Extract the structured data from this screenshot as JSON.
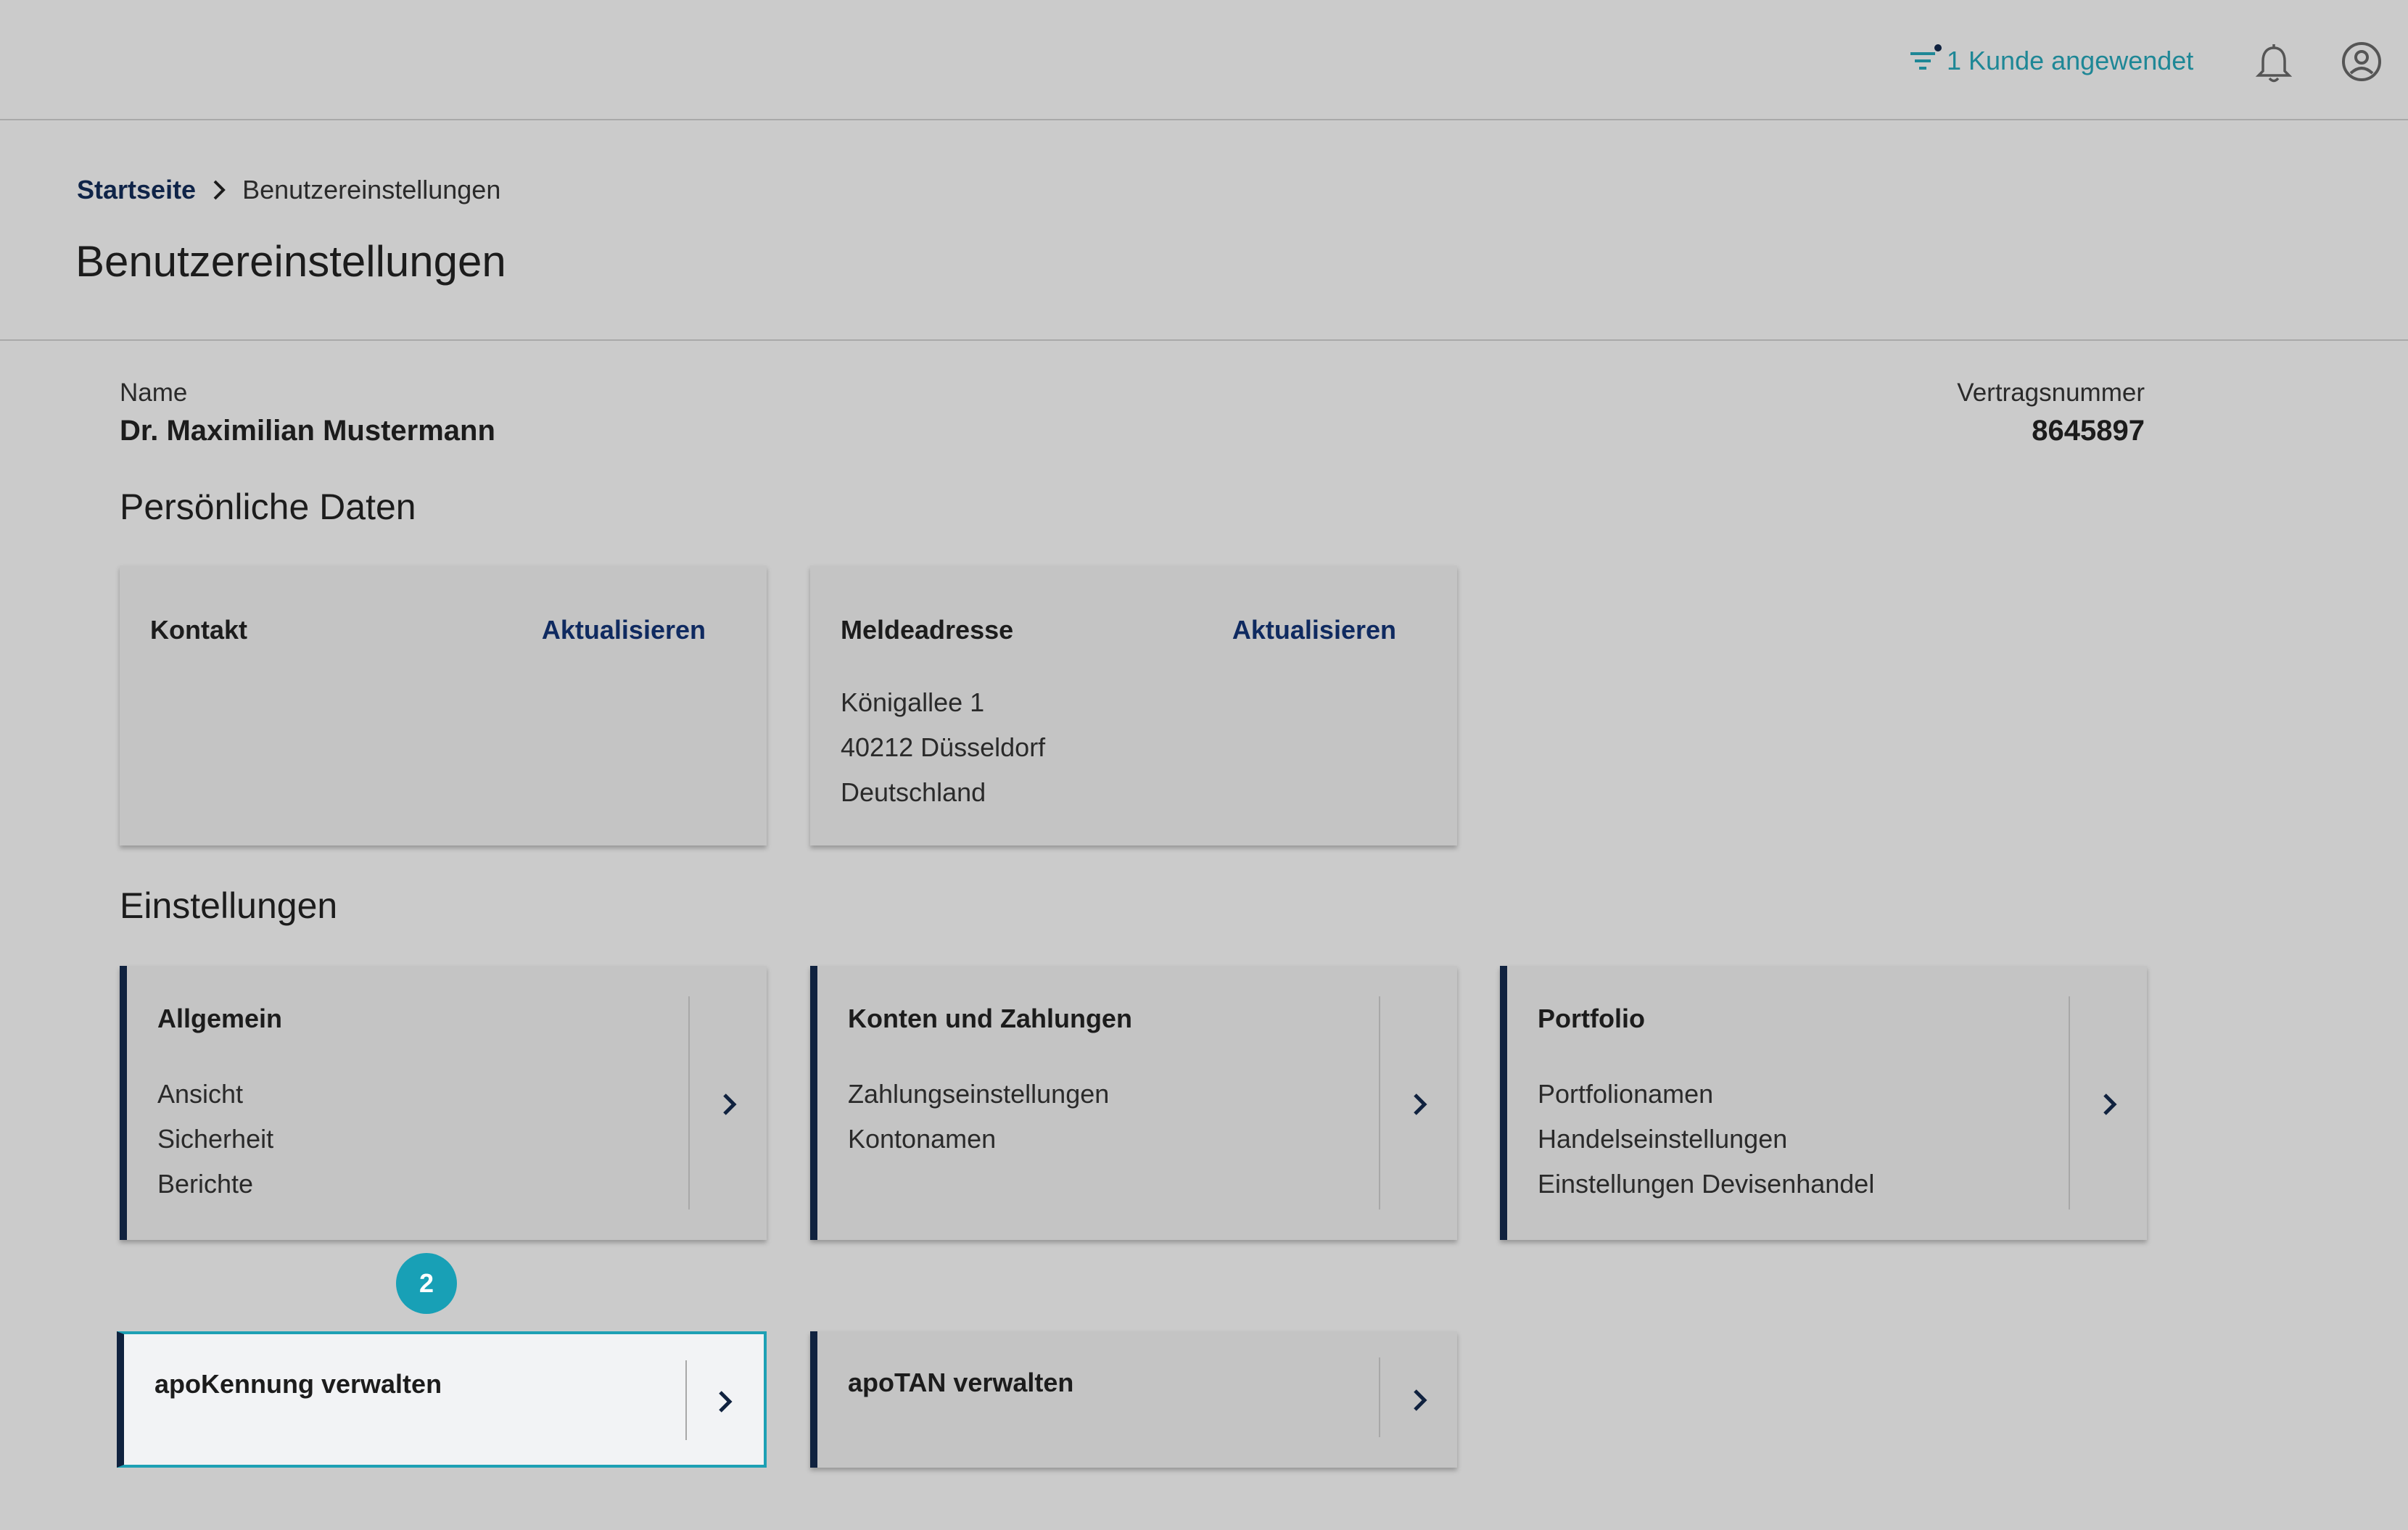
{
  "topbar": {
    "filter_label": "1 Kunde angewendet",
    "accent_color": "#1e8796"
  },
  "breadcrumb": {
    "home": "Startseite",
    "current": "Benutzereinstellungen"
  },
  "page_title": "Benutzereinstellungen",
  "profile": {
    "name_label": "Name",
    "name_value": "Dr. Maximilian Mustermann",
    "contract_label": "Vertragsnummer",
    "contract_value": "8645897"
  },
  "personal": {
    "title": "Persönliche Daten",
    "contact": {
      "title": "Kontakt",
      "action": "Aktualisieren"
    },
    "address": {
      "title": "Meldeadresse",
      "action": "Aktualisieren",
      "lines": [
        "Königallee 1",
        "40212 Düsseldorf",
        "Deutschland"
      ]
    }
  },
  "settings": {
    "title": "Einstellungen",
    "cards": [
      {
        "title": "Allgemein",
        "items": [
          "Ansicht",
          "Sicherheit",
          "Berichte"
        ]
      },
      {
        "title": "Konten und Zahlungen",
        "items": [
          "Zahlungseinstellungen",
          "Kontonamen"
        ]
      },
      {
        "title": "Portfolio",
        "items": [
          "Portfolionamen",
          "Handelseinstellungen",
          "Einstellungen Devisenhandel"
        ]
      }
    ],
    "secondary": [
      {
        "title": "apoKennung verwalten"
      },
      {
        "title": "apoTAN verwalten"
      }
    ]
  },
  "step_badge": "2"
}
